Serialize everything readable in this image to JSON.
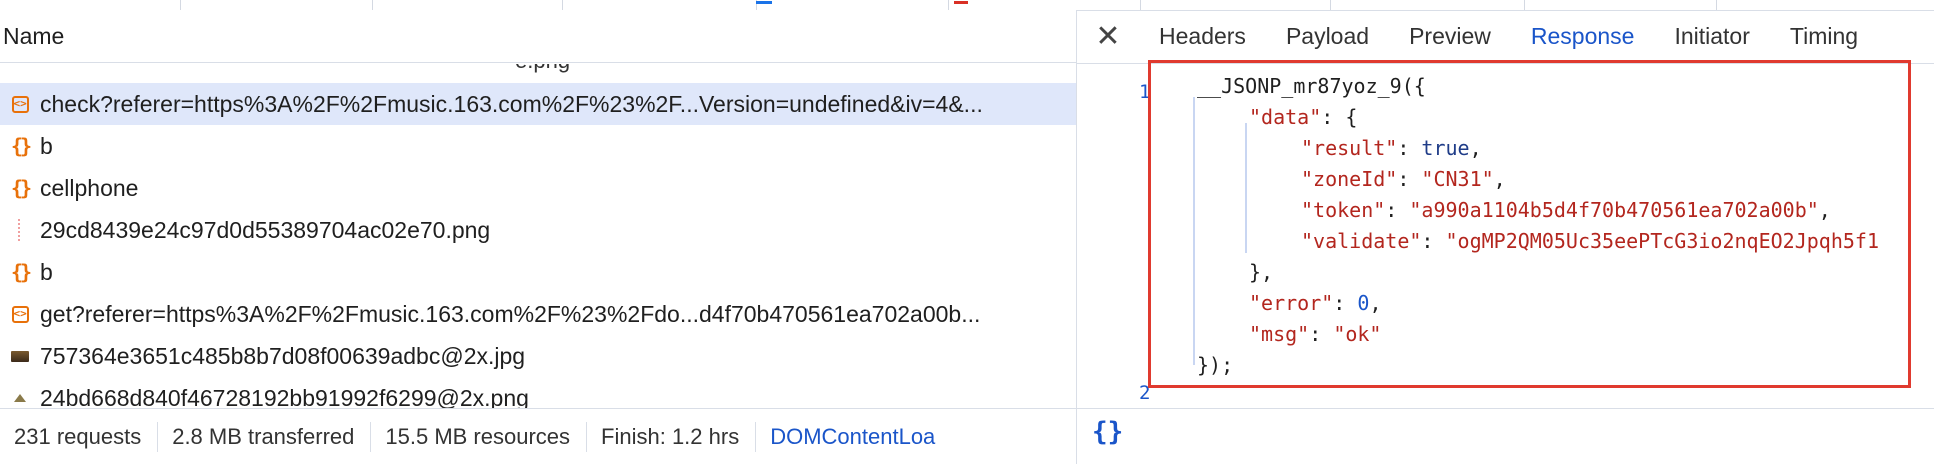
{
  "left_panel": {
    "column_header": "Name",
    "requests": [
      {
        "name": "check?referer=https%3A%2F%2Fmusic.163.com%2F%23%2F...Version=undefined&iv=4&...",
        "icon": "document-icon"
      },
      {
        "name": "b",
        "icon": "script-icon"
      },
      {
        "name": "cellphone",
        "icon": "script-icon"
      },
      {
        "name": "29cd8439e24c97d0d55389704ac02e70.png",
        "icon": "placeholder-icon"
      },
      {
        "name": "b",
        "icon": "script-icon"
      },
      {
        "name": "get?referer=https%3A%2F%2Fmusic.163.com%2F%23%2Fdo...d4f70b470561ea702a00b...",
        "icon": "document-icon"
      },
      {
        "name": "757364e3651c485b8b7d08f00639adbc@2x.jpg",
        "icon": "image-icon"
      },
      {
        "name": "24bd668d840f46728192bb91992f6299@2x.png",
        "icon": "image-icon"
      }
    ],
    "status_bar": {
      "requests": "231 requests",
      "transferred": "2.8 MB transferred",
      "resources": "15.5 MB resources",
      "finish": "Finish: 1.2 hrs",
      "domcontent": "DOMContentLoa"
    }
  },
  "right_panel": {
    "close_glyph": "✕",
    "tabs": [
      "Headers",
      "Payload",
      "Preview",
      "Response",
      "Initiator",
      "Timing"
    ],
    "active_tab": "Response",
    "line_numbers": [
      "1",
      "2"
    ],
    "response": {
      "callback": "__JSONP_mr87yoz_9",
      "data_key": "\"data\"",
      "result_key": "\"result\"",
      "result_value": "true",
      "zoneId_key": "\"zoneId\"",
      "zoneId_value": "\"CN31\"",
      "token_key": "\"token\"",
      "token_value": "\"a990a1104b5d4f70b470561ea702a00b\"",
      "validate_key": "\"validate\"",
      "validate_value": "\"ogMP2QM05Uc35eePTcG3io2nqEO2Jpqh5f1",
      "error_key": "\"error\"",
      "error_value": "0",
      "msg_key": "\"msg\"",
      "msg_value": "\"ok\""
    },
    "format_button": "{}"
  },
  "colors": {
    "accent": "#1a55c9",
    "selected_row": "#dfe7fa",
    "highlight_box": "#e03a2f",
    "string": "#b3261e"
  }
}
